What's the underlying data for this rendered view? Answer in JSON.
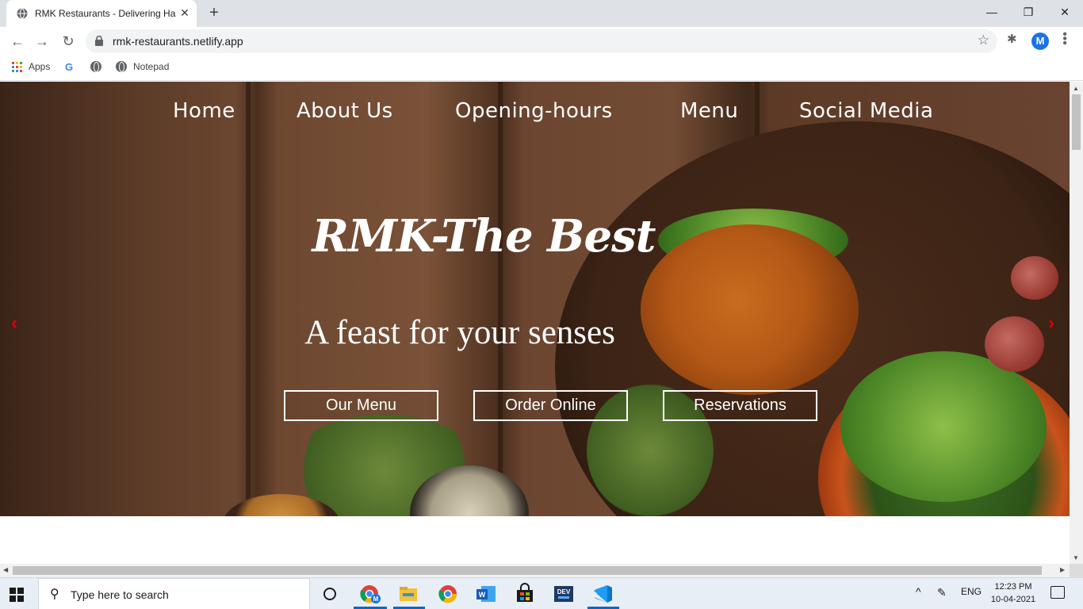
{
  "browser": {
    "tab_title": "RMK Restaurants - Delivering Ha",
    "tab_close": "✕",
    "new_tab": "+",
    "url": "rmk-restaurants.netlify.app",
    "window_controls": {
      "minimize": "—",
      "maximize": "❐",
      "close": "✕"
    },
    "bookmarks": [
      {
        "label": "Apps",
        "icon": "apps-grid-icon"
      },
      {
        "label": "",
        "icon": "google-icon"
      },
      {
        "label": "",
        "icon": "globe-icon"
      },
      {
        "label": "Notepad",
        "icon": "globe-icon"
      }
    ],
    "profile_initial": "M"
  },
  "site": {
    "nav": [
      {
        "label": "Home"
      },
      {
        "label": "About Us"
      },
      {
        "label": "Opening-hours"
      },
      {
        "label": "Menu"
      },
      {
        "label": "Social Media"
      }
    ],
    "brand": "RMK-The Best",
    "tagline": "A feast for your senses",
    "buttons": [
      {
        "label": "Our Menu"
      },
      {
        "label": "Order Online"
      },
      {
        "label": "Reservations"
      }
    ],
    "carousel_prev": "‹",
    "carousel_next": "›",
    "arrow_color": "#e00000"
  },
  "taskbar": {
    "search_placeholder": "Type here to search",
    "language": "ENG",
    "time": "12:23 PM",
    "date": "10-04-2021",
    "apps": [
      "chrome-profile-icon",
      "file-explorer-icon",
      "chrome-icon",
      "word-icon",
      "store-icon",
      "dev-icon",
      "vscode-icon"
    ]
  }
}
